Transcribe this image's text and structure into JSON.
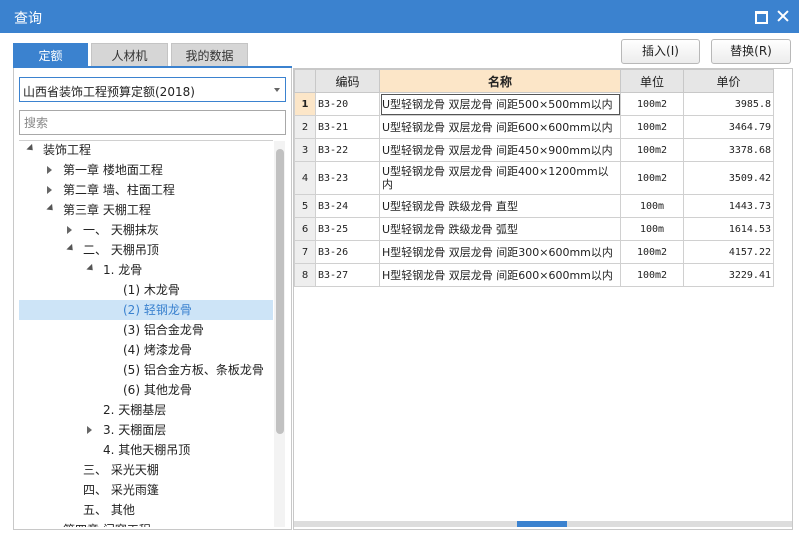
{
  "window": {
    "title": "查询"
  },
  "tabs": [
    {
      "label": "定额"
    },
    {
      "label": "人材机"
    },
    {
      "label": "我的数据"
    }
  ],
  "toolbar": {
    "insert_label": "插入(I)",
    "replace_label": "替换(R)"
  },
  "left": {
    "selected_library": "山西省装饰工程预算定额(2018)",
    "search_placeholder": "搜索"
  },
  "tree": [
    {
      "label": "装饰工程",
      "toggle": "expanded"
    },
    {
      "label": "第一章 楼地面工程",
      "toggle": "collapsed"
    },
    {
      "label": "第二章 墙、柱面工程",
      "toggle": "collapsed"
    },
    {
      "label": "第三章 天棚工程",
      "toggle": "expanded"
    },
    {
      "label": "一、 天棚抹灰",
      "toggle": "collapsed"
    },
    {
      "label": "二、 天棚吊顶",
      "toggle": "expanded"
    },
    {
      "label": "1. 龙骨",
      "toggle": "expanded"
    },
    {
      "label": "(1) 木龙骨",
      "toggle": "none"
    },
    {
      "label": "(2) 轻钢龙骨",
      "toggle": "none",
      "selected": true
    },
    {
      "label": "(3) 铝合金龙骨",
      "toggle": "none"
    },
    {
      "label": "(4) 烤漆龙骨",
      "toggle": "none"
    },
    {
      "label": "(5) 铝合金方板、条板龙骨",
      "toggle": "none"
    },
    {
      "label": "(6) 其他龙骨",
      "toggle": "none"
    },
    {
      "label": "2. 天棚基层",
      "toggle": "none"
    },
    {
      "label": "3. 天棚面层",
      "toggle": "collapsed"
    },
    {
      "label": "4. 其他天棚吊顶",
      "toggle": "none"
    },
    {
      "label": "三、 采光天棚",
      "toggle": "none"
    },
    {
      "label": "四、 采光雨篷",
      "toggle": "none"
    },
    {
      "label": "五、 其他",
      "toggle": "none"
    },
    {
      "label": "第四章 门窗工程",
      "toggle": "none"
    }
  ],
  "grid": {
    "columns": [
      "编码",
      "名称",
      "单位",
      "单价"
    ],
    "rows": [
      {
        "no": "1",
        "code": "B3-20",
        "name": "U型轻钢龙骨 双层龙骨 间距500×500mm以内",
        "unit": "100m2",
        "price": "3985.8"
      },
      {
        "no": "2",
        "code": "B3-21",
        "name": "U型轻钢龙骨 双层龙骨 间距600×600mm以内",
        "unit": "100m2",
        "price": "3464.79"
      },
      {
        "no": "3",
        "code": "B3-22",
        "name": "U型轻钢龙骨 双层龙骨 间距450×900mm以内",
        "unit": "100m2",
        "price": "3378.68"
      },
      {
        "no": "4",
        "code": "B3-23",
        "name": "U型轻钢龙骨 双层龙骨 间距400×1200mm以内",
        "unit": "100m2",
        "price": "3509.42"
      },
      {
        "no": "5",
        "code": "B3-24",
        "name": "U型轻钢龙骨 跌级龙骨 直型",
        "unit": "100m",
        "price": "1443.73"
      },
      {
        "no": "6",
        "code": "B3-25",
        "name": "U型轻钢龙骨 跌级龙骨 弧型",
        "unit": "100m",
        "price": "1614.53"
      },
      {
        "no": "7",
        "code": "B3-26",
        "name": "H型轻钢龙骨 双层龙骨 间距300×600mm以内",
        "unit": "100m2",
        "price": "4157.22"
      },
      {
        "no": "8",
        "code": "B3-27",
        "name": "H型轻钢龙骨 双层龙骨 间距600×600mm以内",
        "unit": "100m2",
        "price": "3229.41"
      }
    ]
  },
  "colors": {
    "accent": "#3b82cf",
    "header_highlight": "#fce6c8",
    "selection": "#cde4f7"
  }
}
